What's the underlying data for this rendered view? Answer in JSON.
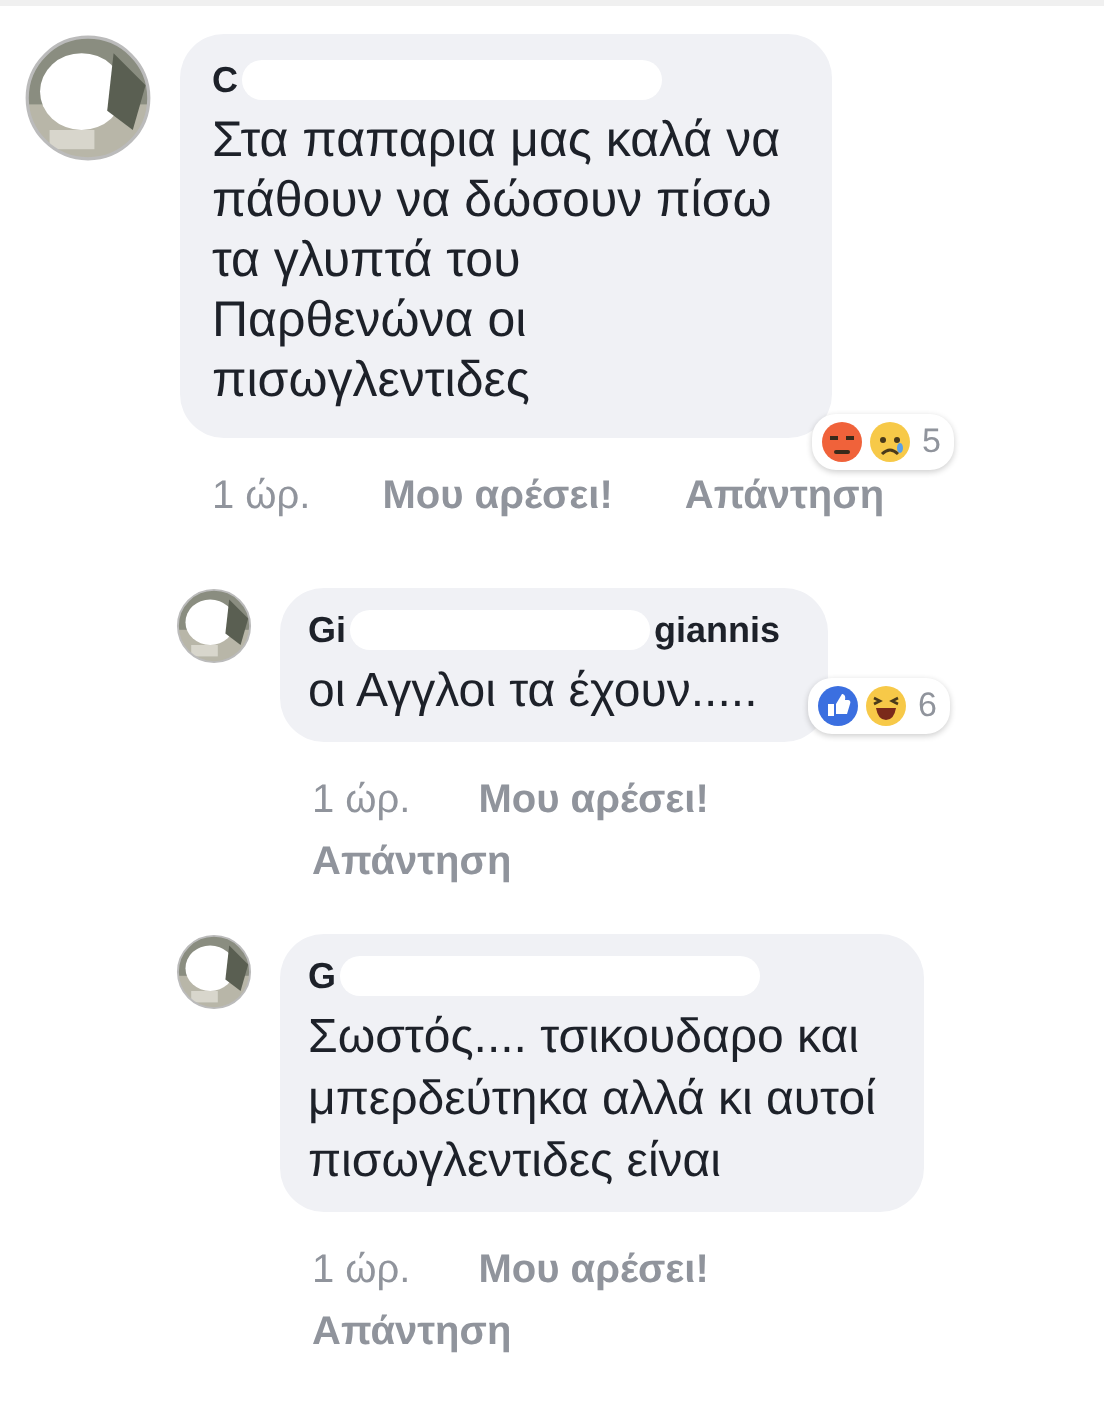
{
  "comments": [
    {
      "kind": "top",
      "name_parts": [
        "C"
      ],
      "text_lines": [
        "Στα παπαρια μας καλά να",
        "πάθουν να δώσουν πίσω",
        "τα γλυπτά του",
        "Παρθενώνα οι",
        "πισωγλεντιδες"
      ],
      "reactions": {
        "icons": [
          {
            "kind": "angry"
          },
          {
            "kind": "sad"
          }
        ],
        "count": "5"
      },
      "time": "1 ώρ.",
      "like": "Μου αρέσει!",
      "reply": "Απάντηση"
    },
    {
      "kind": "reply",
      "name_parts": [
        "Gi",
        "giannis"
      ],
      "text_lines": [
        "οι Αγγλοι τα έχουν....."
      ],
      "reactions": {
        "icons": [
          {
            "kind": "like"
          },
          {
            "kind": "haha"
          }
        ],
        "count": "6"
      },
      "time": "1 ώρ.",
      "like": "Μου αρέσει!",
      "reply": "Απάντηση"
    },
    {
      "kind": "reply",
      "name_parts": [
        "G"
      ],
      "text_lines": [
        "Σωστός.... τσικουδαρο και",
        "μπερδεύτηκα αλλά κι αυτοί",
        "πισωγλεντιδες είναι"
      ],
      "time": "1 ώρ.",
      "like": "Μου αρέσει!",
      "reply": "Απάντηση"
    }
  ]
}
